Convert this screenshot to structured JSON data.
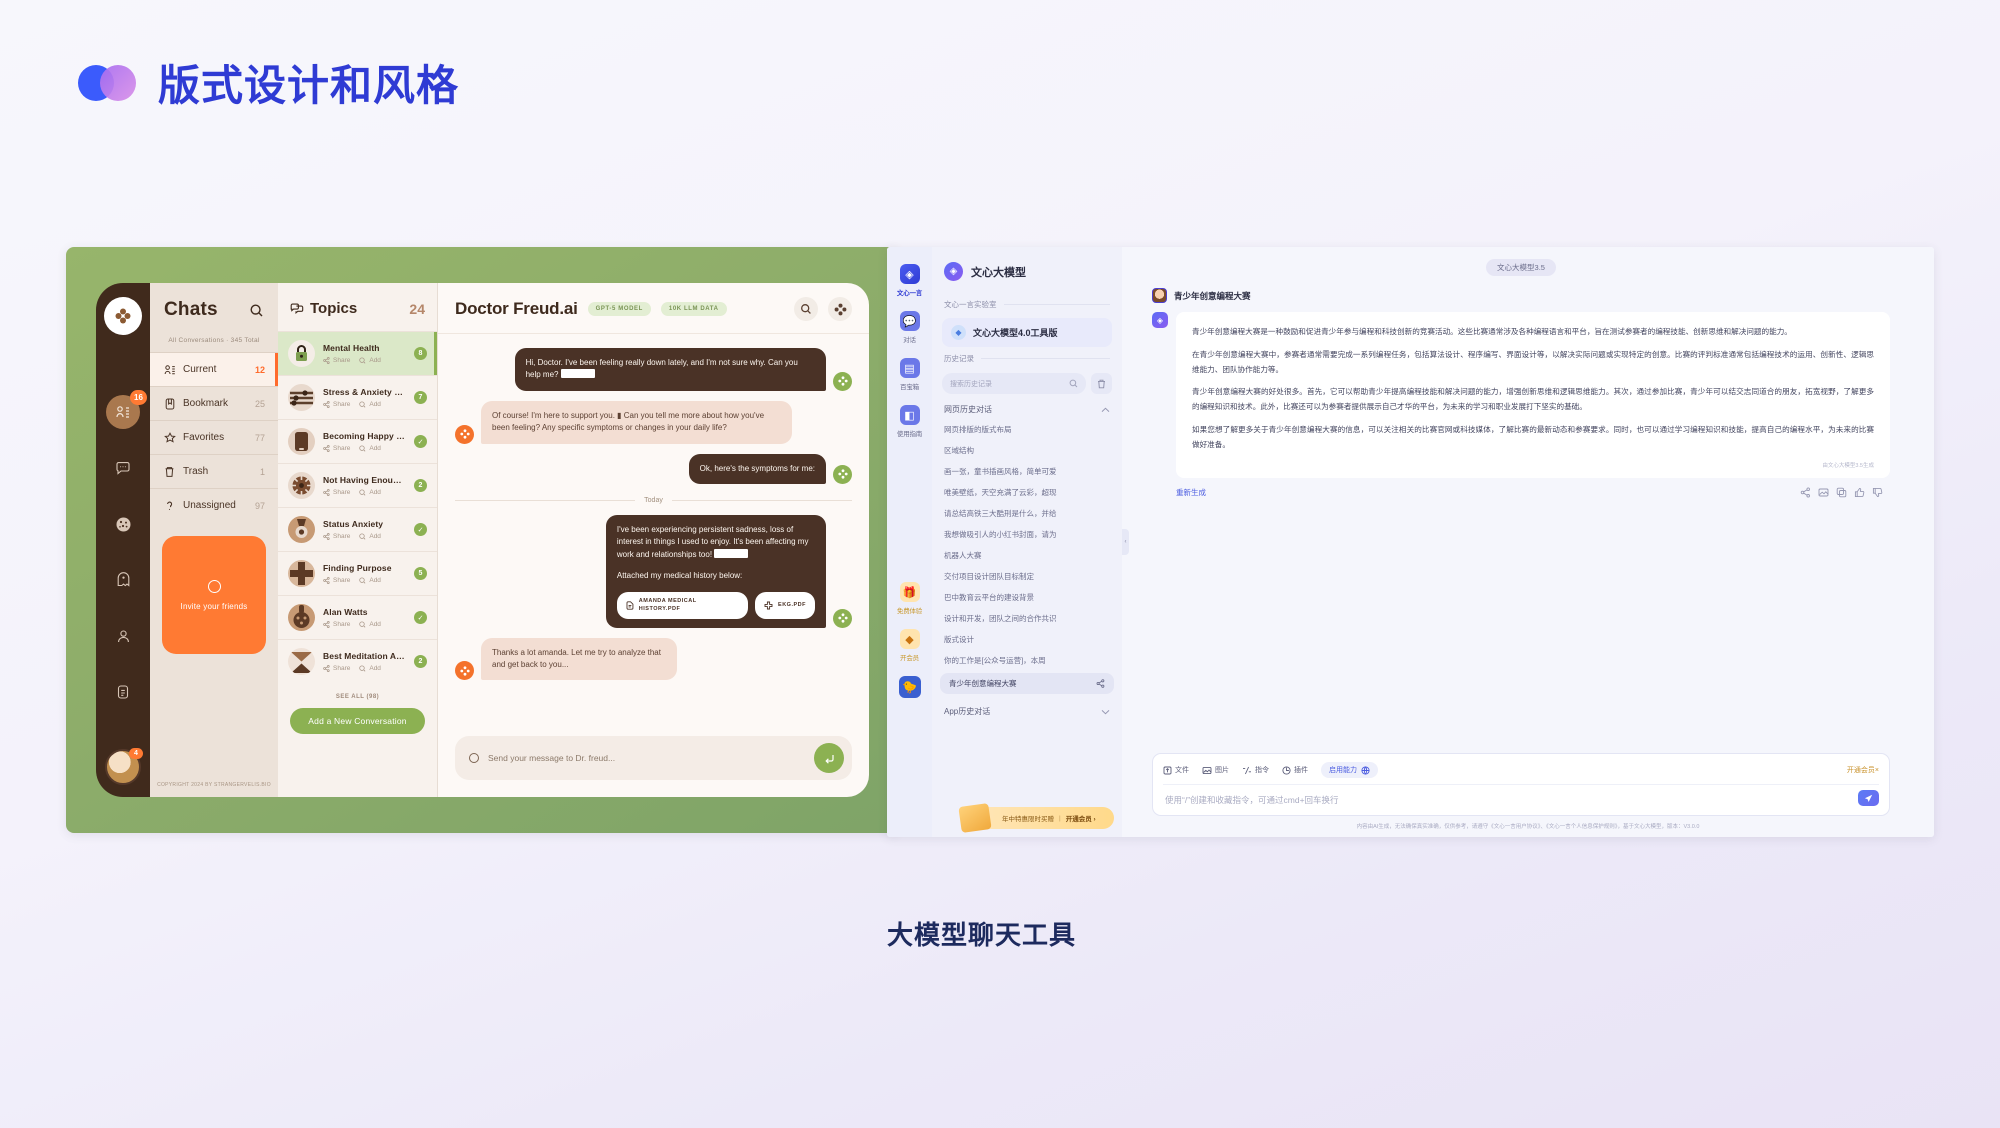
{
  "page": {
    "title": "版式设计和风格",
    "caption": "大模型聊天工具",
    "brand_color_a": "#3b5bfc",
    "brand_color_b": "#b47ee8",
    "title_color": "#2f3bd4"
  },
  "left_app": {
    "rail": {
      "logo_icon": "clover-logo-icon",
      "items": [
        {
          "icon": "contacts-icon",
          "badge": "16",
          "active": true
        },
        {
          "icon": "chat-bubble-icon",
          "badge": "",
          "active": false
        },
        {
          "icon": "cookie-icon",
          "badge": "",
          "active": false
        },
        {
          "icon": "ghost-icon",
          "badge": "",
          "active": false
        },
        {
          "icon": "person-icon",
          "badge": "",
          "active": false
        },
        {
          "icon": "document-icon",
          "badge": "",
          "active": false
        }
      ],
      "avatar_badge": "4"
    },
    "chats": {
      "title": "Chats",
      "search_icon": "search-icon",
      "subtitle": "All Conversations  ·  345 Total",
      "nav": [
        {
          "icon": "contacts-icon",
          "label": "Current",
          "count": "12",
          "active": true
        },
        {
          "icon": "bookmark-icon",
          "label": "Bookmark",
          "count": "25",
          "active": false
        },
        {
          "icon": "star-icon",
          "label": "Favorites",
          "count": "77",
          "active": false
        },
        {
          "icon": "trash-icon",
          "label": "Trash",
          "count": "1",
          "active": false
        },
        {
          "icon": "question-icon",
          "label": "Unassigned",
          "count": "97",
          "active": false
        }
      ],
      "invite": {
        "icon": "circle-plus-icon",
        "label": "Invite your friends"
      },
      "copyright": "COPYRIGHT 2024\nBY STRANGERVELIS.BIO"
    },
    "topics": {
      "icon": "topics-icon",
      "title": "Topics",
      "count": "24",
      "share_label": "Share",
      "add_label": "Add",
      "items": [
        {
          "name": "Mental Health",
          "badge": "8",
          "done": false,
          "active": true
        },
        {
          "name": "Stress & Anxiety Eve...",
          "badge": "7",
          "done": false,
          "active": false
        },
        {
          "name": "Becoming Happy For...",
          "badge": "",
          "done": true,
          "active": false
        },
        {
          "name": "Not Having Enough...",
          "badge": "2",
          "done": false,
          "active": false
        },
        {
          "name": "Status Anxiety",
          "badge": "",
          "done": true,
          "active": false
        },
        {
          "name": "Finding Purpose",
          "badge": "5",
          "done": false,
          "active": false
        },
        {
          "name": "Alan Watts",
          "badge": "",
          "done": true,
          "active": false
        },
        {
          "name": "Best Meditation Apps",
          "badge": "2",
          "done": false,
          "active": false
        }
      ],
      "see_all": "SEE ALL (98)",
      "add_button": "Add a New Conversation"
    },
    "chat": {
      "name": "Doctor Freud.ai",
      "badges": [
        "GPT-5 MODEL",
        "10K LLM DATA"
      ],
      "search_icon": "search-icon",
      "menu_icon": "clover-icon",
      "day_separator": "Today",
      "messages": [
        {
          "side": "out",
          "text": "Hi, Doctor. I've been feeling really down lately, and I'm not sure why. Can you help me?",
          "redacted": true
        },
        {
          "side": "in",
          "text": "Of course! I'm here to support you. ▮ Can you tell me more about how you've been feeling? Any specific symptoms or changes in your daily life?",
          "redacted": false
        },
        {
          "side": "out",
          "text": "Ok, here's the symptoms for me:",
          "redacted": false
        },
        {
          "side": "out",
          "text": "I've been experiencing persistent sadness, loss of interest in things I used to enjoy. It's been affecting my work and relationships too!",
          "redacted": true,
          "attach_intro": "Attached my medical history below:",
          "attachments": [
            "AMANDA MEDICAL HISTORY.PDF",
            "EKG.PDF"
          ]
        },
        {
          "side": "in",
          "text": "Thanks a lot amanda. Let me try to analyze that and get back to you...",
          "redacted": false
        }
      ],
      "composer_placeholder": "Send your message to Dr. freud...",
      "send_icon": "enter-arrow-icon"
    }
  },
  "right_app": {
    "rail": [
      {
        "icon": "wenxin-logo-icon",
        "label": "文心一言",
        "style": "brand"
      },
      {
        "icon": "chat-icon",
        "label": "对话",
        "style": "normal"
      },
      {
        "icon": "toolbox-icon",
        "label": "百宝箱",
        "style": "normal"
      },
      {
        "icon": "guide-icon",
        "label": "使用指南",
        "style": "normal"
      },
      {
        "icon": "gift-icon",
        "label": "免费体验",
        "style": "gold"
      },
      {
        "icon": "vip-diamond-icon",
        "label": "开会员",
        "style": "gold"
      },
      {
        "icon": "duck-avatar-icon",
        "label": "",
        "style": "normal"
      }
    ],
    "sidebar": {
      "title": "文心大模型",
      "lab_section": "文心一言实验室",
      "model_name": "文心大模型4.0工具版",
      "history_section": "历史记录",
      "search_placeholder": "搜索历史记录",
      "search_icon": "search-icon",
      "trash_icon": "trash-icon",
      "group_web": "网页历史对话",
      "group_app": "App历史对话",
      "history": [
        "网页排版的版式布局",
        "区域结构",
        "画一张，童书插画风格，简单可爱",
        "唯美壁纸，天空充满了云彩，超现",
        "请总结高铁三大酷刑是什么，并给",
        "我想做吸引人的小红书封面，请为",
        "机器人大赛",
        "交付项目设计团队目标制定",
        "巴中教育云平台的建设背景",
        "设计和开发，团队之间的合作共识",
        "版式设计",
        "你的工作是[公众号运营]，本周"
      ],
      "selected_history": "青少年创意编程大赛",
      "share_icon": "share-icon",
      "promo": {
        "text": "年中特惠限时买赠",
        "cta": "开通会员 ›"
      }
    },
    "main": {
      "model_chip": "文心大模型3.5",
      "question": "青少年创意编程大赛",
      "answer_paragraphs": [
        "青少年创意编程大赛是一种鼓励和促进青少年参与编程和科技创新的竞赛活动。这些比赛通常涉及各种编程语言和平台，旨在测试参赛者的编程技能、创新思维和解决问题的能力。",
        "在青少年创意编程大赛中，参赛者通常需要完成一系列编程任务，包括算法设计、程序编写、界面设计等，以解决实际问题或实现特定的创意。比赛的评判标准通常包括编程技术的运用、创新性、逻辑思维能力、团队协作能力等。",
        "青少年创意编程大赛的好处很多。首先，它可以帮助青少年提高编程技能和解决问题的能力，增强创新思维和逻辑思维能力。其次，通过参加比赛，青少年可以结交志同道合的朋友，拓宽视野，了解更多的编程知识和技术。此外，比赛还可以为参赛者提供展示自己才华的平台，为未来的学习和职业发展打下坚实的基础。",
        "如果您想了解更多关于青少年创意编程大赛的信息，可以关注相关的比赛官网或科技媒体，了解比赛的最新动态和参赛要求。同时，也可以通过学习编程知识和技能，提高自己的编程水平，为未来的比赛做好准备。"
      ],
      "generated_by": "由文心大模型3.5生成",
      "regenerate": "重新生成",
      "action_icons": [
        "share-icon",
        "image-icon",
        "copy-icon",
        "thumbs-up-icon",
        "thumbs-down-icon"
      ],
      "composer": {
        "tools": [
          {
            "icon": "file-icon",
            "label": "文件"
          },
          {
            "icon": "image-icon",
            "label": "图片"
          },
          {
            "icon": "command-icon",
            "label": "指令"
          },
          {
            "icon": "plugin-icon",
            "label": "插件"
          }
        ],
        "ability_pill": "启用能力",
        "ability_icon": "globe-icon",
        "vip_label": "开通会员×",
        "placeholder": "使用“/”创建和收藏指令，可通过cmd+回车换行",
        "send_icon": "send-plane-icon"
      },
      "footer": "内容由AI生成，无法确保真实准确，仅供参考，请遵守《文心一言用户协议》、《文心一言个人信息保护规则》，基于文心大模型，版本：V3.0.0"
    }
  }
}
